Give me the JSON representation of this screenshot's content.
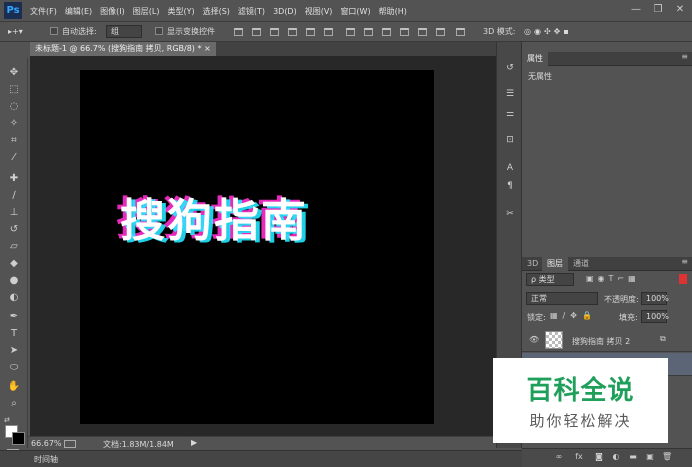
{
  "app": {
    "logo": "Ps"
  },
  "menu": [
    "文件(F)",
    "编辑(E)",
    "图像(I)",
    "图层(L)",
    "类型(Y)",
    "选择(S)",
    "滤镜(T)",
    "3D(D)",
    "视图(V)",
    "窗口(W)",
    "帮助(H)"
  ],
  "window_controls": {
    "minimize": "—",
    "restore": "❐",
    "close": "✕"
  },
  "options": {
    "auto_select_label": "自动选择:",
    "auto_select_value": "组",
    "show_transform_label": "显示变换控件",
    "mode_3d_label": "3D 模式:"
  },
  "document": {
    "tab_title": "未标题-1 @ 66.7% (搜狗指南 拷贝, RGB/8) *",
    "canvas_text": "搜狗指南"
  },
  "status": {
    "zoom": "66.67%",
    "doc_info": "文档:1.83M/1.84M"
  },
  "timeline": {
    "label": "时间轴"
  },
  "properties": {
    "tab": "属性",
    "no_properties": "无属性"
  },
  "layers_panel": {
    "tabs": [
      "3D",
      "图层",
      "通道"
    ],
    "filter_kind": "ρ 类型",
    "blend_mode": "正常",
    "opacity_label": "不透明度:",
    "opacity_value": "100%",
    "lock_label": "锁定:",
    "fill_label": "填充:",
    "fill_value": "100%",
    "layers": [
      {
        "name": "搜狗指南 拷贝 2",
        "visible": true
      }
    ]
  },
  "watermark": {
    "title": "百科全说",
    "subtitle": "助你轻松解决"
  },
  "colors": {
    "accent_blue": "#35a7ff",
    "glitch_magenta": "#ff2fd0",
    "glitch_cyan": "#23e7ff",
    "watermark_green": "#1fa05a"
  }
}
